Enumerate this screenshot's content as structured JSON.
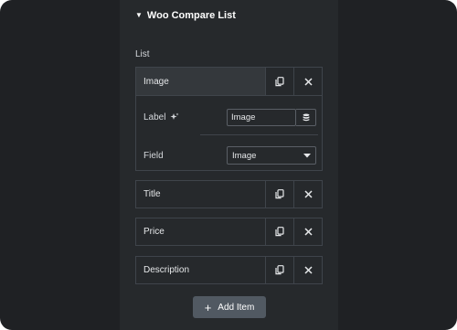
{
  "section": {
    "title": "Woo Compare List",
    "caret_glyph": "▼"
  },
  "list": {
    "label": "List"
  },
  "items": [
    {
      "title": "Image"
    },
    {
      "title": "Title"
    },
    {
      "title": "Price"
    },
    {
      "title": "Description"
    }
  ],
  "expanded": {
    "label_field": {
      "label": "Label",
      "value": "Image"
    },
    "field_select": {
      "label": "Field",
      "value": "Image"
    }
  },
  "add_button": {
    "label": "Add Item",
    "plus_glyph": "+"
  },
  "icons": {
    "duplicate": "copy-icon",
    "remove": "close-icon",
    "ai": "sparkle-icon",
    "dynamic": "database-icon",
    "dropdown": "caret-down-icon"
  },
  "colors": {
    "background": "#1f2124",
    "panel": "#26292c",
    "border": "#3f444b",
    "button": "#515962",
    "text": "#d5d8dc"
  }
}
